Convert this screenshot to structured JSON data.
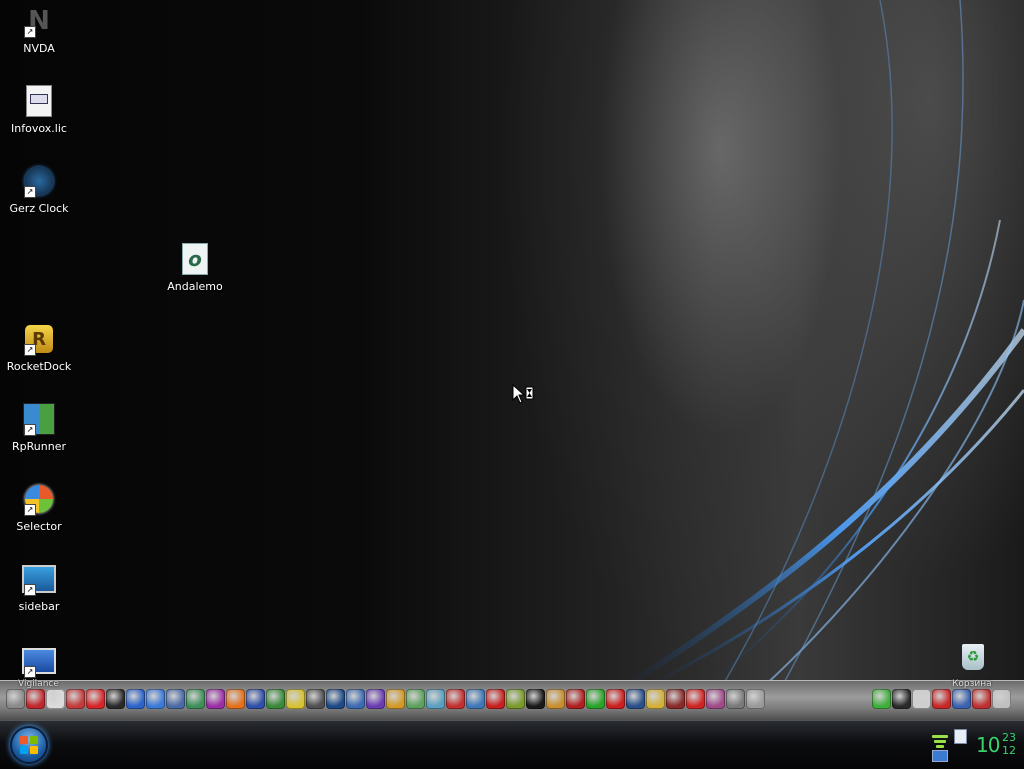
{
  "desktop": {
    "icons": [
      {
        "label": "NVDA",
        "icon": "nvda-icon",
        "shortcut": true
      },
      {
        "label": "Infovox.lic",
        "icon": "document-icon",
        "shortcut": false
      },
      {
        "label": "Gerz Clock",
        "icon": "clock-icon",
        "shortcut": true
      },
      {
        "label": "Andalemo",
        "icon": "andalemo-icon",
        "shortcut": false
      },
      {
        "label": "RocketDock",
        "icon": "rocketdock-icon",
        "shortcut": true
      },
      {
        "label": "RpRunner",
        "icon": "rprunner-icon",
        "shortcut": true
      },
      {
        "label": "Selector",
        "icon": "windows-orb-icon",
        "shortcut": true
      },
      {
        "label": "sidebar",
        "icon": "sidebar-icon",
        "shortcut": true
      },
      {
        "label": "",
        "icon": "monitor-icon",
        "shortcut": true
      },
      {
        "label": "",
        "icon": "recycle-bin-icon",
        "shortcut": false
      }
    ]
  },
  "dock": {
    "left_label": "Vigilance",
    "right_label": "Корзина",
    "icons": [
      {
        "name": "utility-icon",
        "color": "#8a8a8a"
      },
      {
        "name": "security-icon",
        "color": "#c0282d"
      },
      {
        "name": "clock-icon",
        "color": "#dcdcdc"
      },
      {
        "name": "app-icon",
        "color": "#c33b3b"
      },
      {
        "name": "acrobat-icon",
        "color": "#d6262a"
      },
      {
        "name": "tool-icon",
        "color": "#2a2a2a"
      },
      {
        "name": "d-app-icon",
        "color": "#2c63c9"
      },
      {
        "name": "pencil-icon",
        "color": "#3c7ad8"
      },
      {
        "name": "cube-icon",
        "color": "#4a6aa6"
      },
      {
        "name": "image-icon",
        "color": "#3e8f59"
      },
      {
        "name": "media-icon",
        "color": "#9b2fa7"
      },
      {
        "name": "firefox-icon",
        "color": "#e3711d"
      },
      {
        "name": "save-icon",
        "color": "#2f4fa8"
      },
      {
        "name": "map-icon",
        "color": "#3a8a3a"
      },
      {
        "name": "cd-icon",
        "color": "#d7c233"
      },
      {
        "name": "theater-icon",
        "color": "#505050"
      },
      {
        "name": "download-icon",
        "color": "#1d4a87"
      },
      {
        "name": "globe-icon",
        "color": "#3d6bb3"
      },
      {
        "name": "picture-icon",
        "color": "#6a3db3"
      },
      {
        "name": "basket-icon",
        "color": "#d39a2a"
      },
      {
        "name": "gear-icon",
        "color": "#5ea15e"
      },
      {
        "name": "ring-icon",
        "color": "#5aa0c0"
      },
      {
        "name": "red-ball-icon",
        "color": "#c23030"
      },
      {
        "name": "at-icon",
        "color": "#3f78b8"
      },
      {
        "name": "r-app-icon",
        "color": "#c82020"
      },
      {
        "name": "archive-icon",
        "color": "#7a9a2a"
      },
      {
        "name": "res-icon",
        "color": "#1a1a1a"
      },
      {
        "name": "eye-icon",
        "color": "#c88f30"
      },
      {
        "name": "block-icon",
        "color": "#b02020"
      },
      {
        "name": "clover-icon",
        "color": "#28a428"
      },
      {
        "name": "opera-icon",
        "color": "#cc1f1f"
      },
      {
        "name": "photoshop-icon",
        "color": "#2a4f8a"
      },
      {
        "name": "key-icon",
        "color": "#d2b03a"
      },
      {
        "name": "flag-icon",
        "color": "#8a2a2a"
      },
      {
        "name": "o-app-icon",
        "color": "#d02525"
      },
      {
        "name": "books-icon",
        "color": "#a04a8a"
      },
      {
        "name": "scanner-icon",
        "color": "#7a7a7a"
      },
      {
        "name": "mouse-icon",
        "color": "#9a9a9a"
      }
    ],
    "right_icons": [
      {
        "name": "utorrent-icon",
        "color": "#3fae3a"
      },
      {
        "name": "spider-icon",
        "color": "#2a2a2a"
      },
      {
        "name": "stamp-icon",
        "color": "#cfcfcf"
      },
      {
        "name": "c-app-icon",
        "color": "#c82828"
      },
      {
        "name": "network-icon",
        "color": "#3a62b0"
      },
      {
        "name": "cube-red-icon",
        "color": "#c03030"
      },
      {
        "name": "trash-icon",
        "color": "#c0c0c0"
      }
    ]
  },
  "taskbar": {
    "start_button": "start-orb",
    "clock": {
      "hour": "10",
      "minute": "23",
      "second": "12"
    }
  }
}
